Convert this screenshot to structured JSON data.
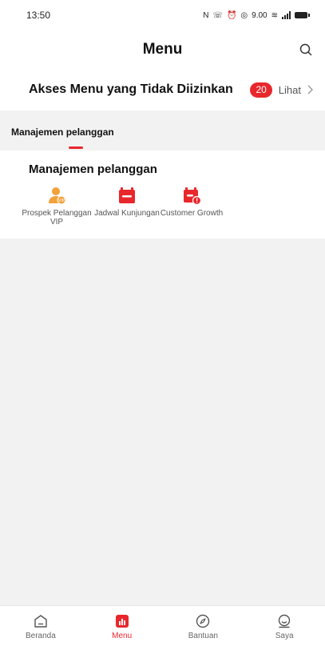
{
  "status_bar": {
    "time": "13:50",
    "net_speed": "9.00"
  },
  "header": {
    "title": "Menu"
  },
  "denied": {
    "title": "Akses Menu yang Tidak Diizinkan",
    "count": "20",
    "link_label": "Lihat"
  },
  "tabs": [
    {
      "label": "Manajemen pelanggan"
    }
  ],
  "section": {
    "title": "Manajemen pelanggan",
    "items": [
      {
        "label": "Prospek Pelanggan VIP",
        "icon": "vip-prospect-icon"
      },
      {
        "label": "Jadwal Kunjungan",
        "icon": "calendar-icon"
      },
      {
        "label": "Customer Growth",
        "icon": "growth-calendar-icon"
      }
    ]
  },
  "nav": [
    {
      "label": "Beranda",
      "icon": "home-icon"
    },
    {
      "label": "Menu",
      "icon": "menu-chart-icon"
    },
    {
      "label": "Bantuan",
      "icon": "compass-icon"
    },
    {
      "label": "Saya",
      "icon": "profile-icon"
    }
  ],
  "colors": {
    "accent": "#e8272c",
    "icon_orange": "#f3a13a",
    "background": "#f2f2f2"
  }
}
